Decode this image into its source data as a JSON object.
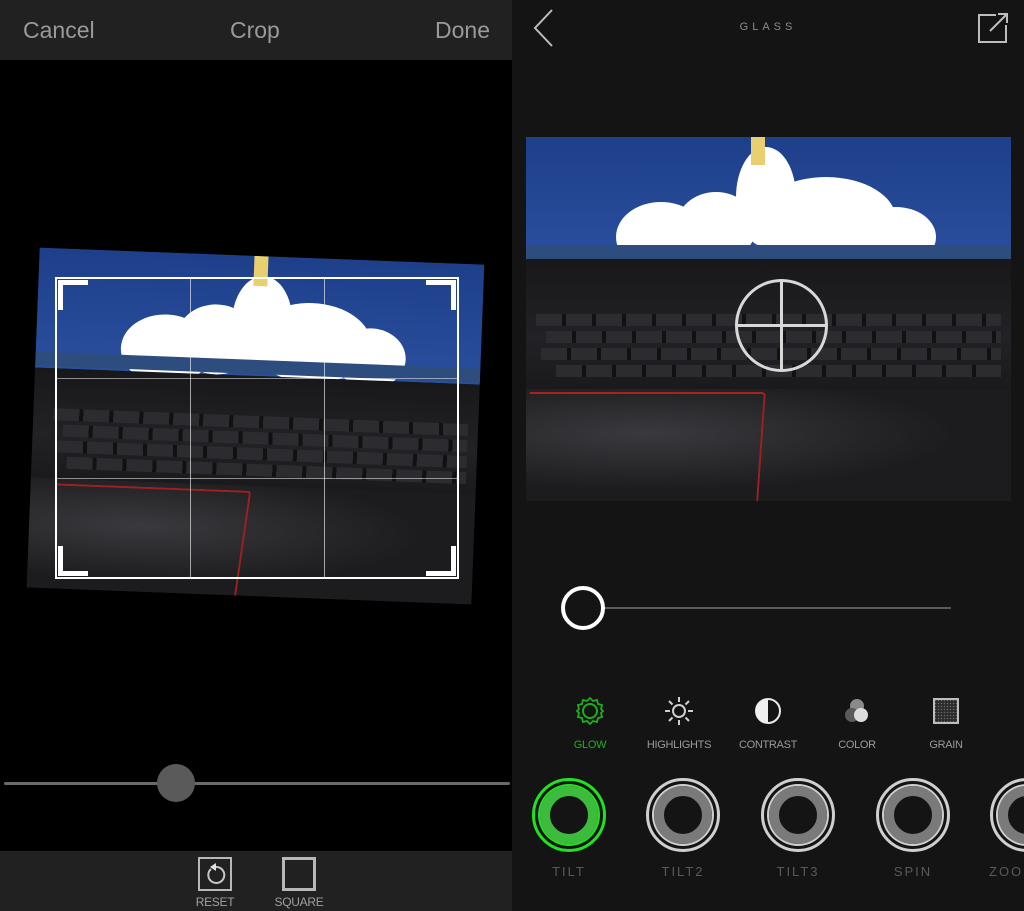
{
  "crop_screen": {
    "header": {
      "cancel_label": "Cancel",
      "title": "Crop",
      "done_label": "Done"
    },
    "rotation_slider": {
      "value_fraction": 0.34
    },
    "footer": {
      "tools": [
        {
          "label": "RESET",
          "icon": "rotate-ccw-icon"
        },
        {
          "label": "SQUARE",
          "icon": "square-icon"
        }
      ]
    }
  },
  "glass_screen": {
    "header": {
      "title": "GLASS",
      "back_icon": "chevron-left-icon",
      "share_icon": "share-external-icon"
    },
    "intensity_slider": {
      "value_fraction": 0.0
    },
    "adjustments": [
      {
        "label": "GLOW",
        "icon": "sun-gear-icon",
        "active": true
      },
      {
        "label": "HIGHLIGHTS",
        "icon": "sun-icon",
        "active": false
      },
      {
        "label": "CONTRAST",
        "icon": "half-circle-icon",
        "active": false
      },
      {
        "label": "COLOR",
        "icon": "color-circles-icon",
        "active": false
      },
      {
        "label": "GRAIN",
        "icon": "grain-square-icon",
        "active": false
      }
    ],
    "presets": [
      {
        "label": "TILT",
        "active": true
      },
      {
        "label": "TILT2",
        "active": false
      },
      {
        "label": "TILT3",
        "active": false
      },
      {
        "label": "SPIN",
        "active": false
      },
      {
        "label": "ZOOM",
        "active": false
      }
    ]
  },
  "colors": {
    "accent_green": "#22e022",
    "active_label_green": "#1fae1f",
    "header_dark": "#212121",
    "panel_dark": "#141414"
  }
}
